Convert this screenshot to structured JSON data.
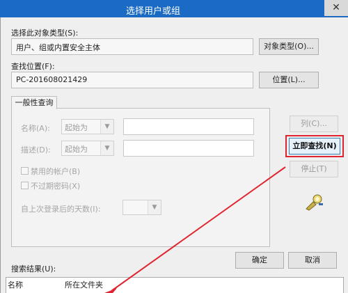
{
  "window": {
    "title": "选择用户或组",
    "close_glyph": "✕"
  },
  "object_type": {
    "label": "选择此对象类型(S):",
    "value": "用户、组或内置安全主体",
    "button": "对象类型(O)..."
  },
  "location": {
    "label": "查找位置(F):",
    "value": "PC-201608021429",
    "button": "位置(L)..."
  },
  "query_tab": {
    "label": "一般性查询"
  },
  "name_row": {
    "label": "名称(A):",
    "mode": "起始为"
  },
  "desc_row": {
    "label": "描述(D):",
    "mode": "起始为"
  },
  "disabled_accounts": {
    "label": "禁用的帐户(B)"
  },
  "no_expire_pwd": {
    "label": "不过期密码(X)"
  },
  "days_since_login": {
    "label": "自上次登录后的天数(I):"
  },
  "side_buttons": {
    "columns": "列(C)...",
    "find_now": "立即查找(N)",
    "stop": "停止(T)"
  },
  "dialog_buttons": {
    "ok": "确定",
    "cancel": "取消"
  },
  "results": {
    "label": "搜索结果(U):",
    "columns": [
      "名称",
      "所在文件夹"
    ]
  },
  "colors": {
    "titlebar": "#1b6bc4",
    "highlight_border": "#e0242f"
  }
}
